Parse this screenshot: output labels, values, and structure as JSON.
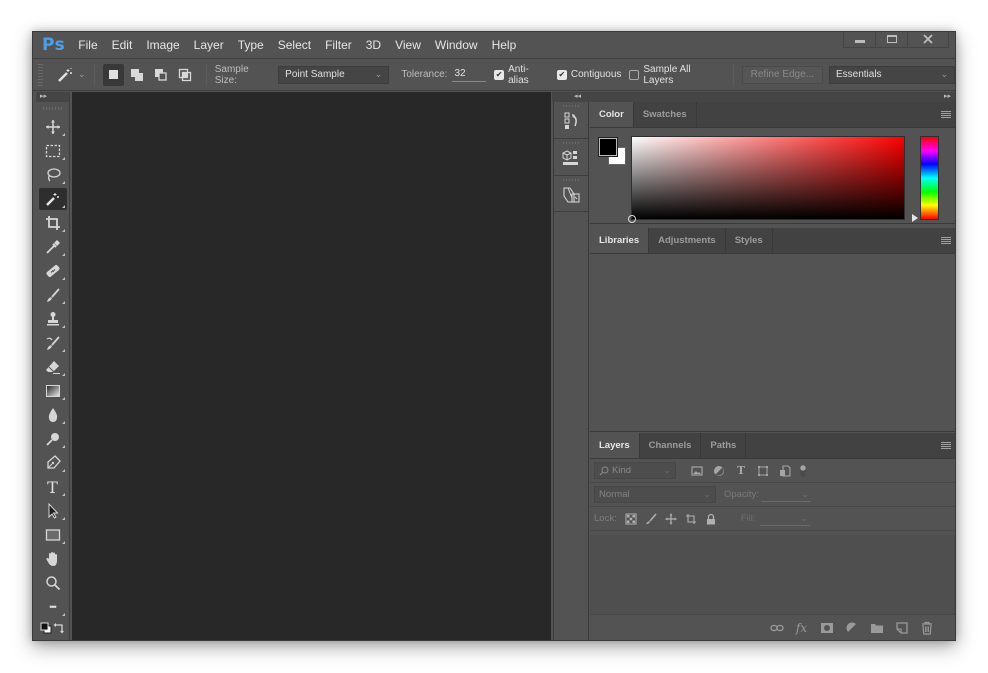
{
  "app": {
    "logo": "Ps",
    "menu": [
      "File",
      "Edit",
      "Image",
      "Layer",
      "Type",
      "Select",
      "Filter",
      "3D",
      "View",
      "Window",
      "Help"
    ],
    "window_controls": {
      "minimize": "minimize-icon",
      "maximize": "maximize-icon",
      "close": "close-icon"
    }
  },
  "options_bar": {
    "tool_preset_icon": "magic-wand-icon",
    "selection_modes": [
      "new-selection",
      "add-to-selection",
      "subtract-from-selection",
      "intersect-with-selection"
    ],
    "active_mode": "new-selection",
    "sample_size_label": "Sample Size:",
    "sample_size_value": "Point Sample",
    "tolerance_label": "Tolerance:",
    "tolerance_value": "32",
    "anti_alias_label": "Anti-alias",
    "anti_alias_checked": true,
    "contiguous_label": "Contiguous",
    "contiguous_checked": true,
    "sample_all_layers_label": "Sample All Layers",
    "sample_all_layers_checked": false,
    "refine_edge_label": "Refine Edge...",
    "workspace_value": "Essentials"
  },
  "toolbar": {
    "collapse_glyph": "▸▸",
    "tools": [
      {
        "name": "move-tool",
        "icon": "move-icon",
        "active": false
      },
      {
        "name": "marquee-tool",
        "icon": "rectangular-marquee-icon",
        "active": false
      },
      {
        "name": "lasso-tool",
        "icon": "lasso-icon",
        "active": false
      },
      {
        "name": "magic-wand-tool",
        "icon": "magic-wand-icon",
        "active": true
      },
      {
        "name": "crop-tool",
        "icon": "crop-icon",
        "active": false
      },
      {
        "name": "eyedropper-tool",
        "icon": "eyedropper-icon",
        "active": false
      },
      {
        "name": "healing-brush-tool",
        "icon": "bandage-icon",
        "active": false
      },
      {
        "name": "brush-tool",
        "icon": "brush-icon",
        "active": false
      },
      {
        "name": "clone-stamp-tool",
        "icon": "stamp-icon",
        "active": false
      },
      {
        "name": "history-brush-tool",
        "icon": "history-brush-icon",
        "active": false
      },
      {
        "name": "eraser-tool",
        "icon": "eraser-icon",
        "active": false
      },
      {
        "name": "gradient-tool",
        "icon": "gradient-icon",
        "active": false
      },
      {
        "name": "blur-tool",
        "icon": "blur-drop-icon",
        "active": false
      },
      {
        "name": "dodge-tool",
        "icon": "dodge-icon",
        "active": false
      },
      {
        "name": "pen-tool",
        "icon": "pen-icon",
        "active": false
      },
      {
        "name": "type-tool",
        "icon": "type-icon",
        "active": false
      },
      {
        "name": "path-selection-tool",
        "icon": "arrow-cursor-icon",
        "active": false
      },
      {
        "name": "rectangle-tool",
        "icon": "rectangle-icon",
        "active": false
      },
      {
        "name": "hand-tool",
        "icon": "hand-icon",
        "active": false
      },
      {
        "name": "zoom-tool",
        "icon": "magnifier-icon",
        "active": false
      },
      {
        "name": "edit-toolbar",
        "icon": "more-dots-icon",
        "active": false
      }
    ],
    "type_glyph": "T",
    "more_glyph": "•••"
  },
  "dock": {
    "collapse_left_glyph": "◂◂",
    "collapse_right_glyph": "▸▸",
    "icons": [
      "history-icon",
      "properties-3d-icon",
      "layer-comps-icon"
    ]
  },
  "color_panel": {
    "tabs": [
      "Color",
      "Swatches"
    ],
    "active_tab": "Color",
    "foreground_color": "#000000",
    "background_color": "#ffffff",
    "hue_color": "#ff0000"
  },
  "libraries_panel": {
    "tabs": [
      "Libraries",
      "Adjustments",
      "Styles"
    ],
    "active_tab": "Libraries"
  },
  "layers_panel": {
    "tabs": [
      "Layers",
      "Channels",
      "Paths"
    ],
    "active_tab": "Layers",
    "kind_placeholder": "Kind",
    "blend_mode": "Normal",
    "opacity_label": "Opacity:",
    "opacity_value": "",
    "lock_label": "Lock:",
    "fill_label": "Fill:",
    "fill_value": "",
    "filter_icons": [
      "pixel-layer-filter-icon",
      "adjustment-layer-filter-icon",
      "type-layer-filter-icon",
      "shape-layer-filter-icon",
      "smart-object-filter-icon",
      "filter-toggle-icon"
    ],
    "lock_icons": [
      "lock-transparent-pixels-icon",
      "lock-image-pixels-icon",
      "lock-position-icon",
      "lock-artboard-icon",
      "lock-all-icon"
    ],
    "footer_icons": [
      "link-layers-icon",
      "fx-icon",
      "add-mask-icon",
      "adjustment-layer-icon",
      "new-group-icon",
      "new-layer-icon",
      "delete-layer-icon"
    ],
    "fx_glyph": "fx",
    "type_glyph": "T"
  }
}
